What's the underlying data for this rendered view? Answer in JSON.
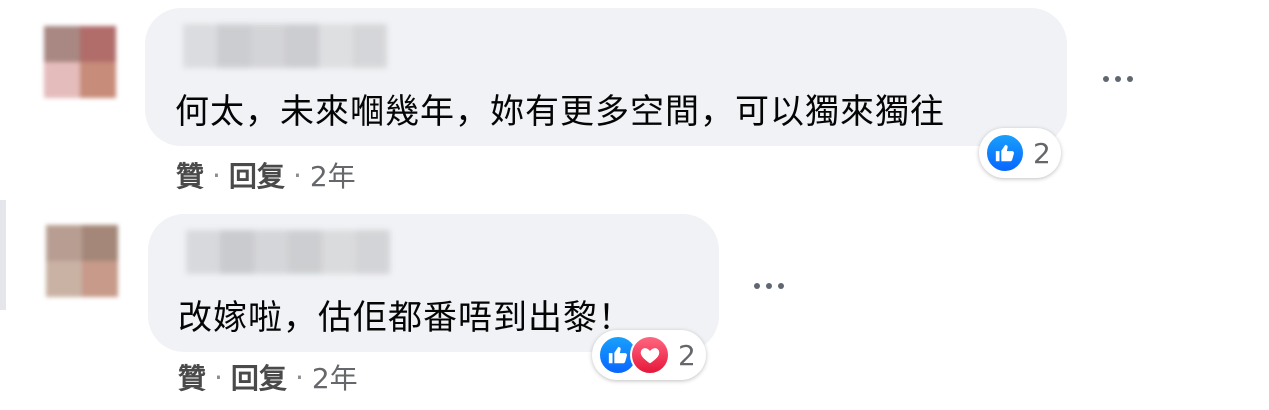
{
  "comments": [
    {
      "text": "何太，未來嗰幾年，妳有更多空間，可以獨來獨往",
      "like_label": "贊",
      "separator": "·",
      "reply_label": "回复",
      "time": "2年",
      "reaction_count": "2",
      "reactions": [
        "like-icon"
      ],
      "avatar_colors": [
        "#a98783",
        "#b06d6a",
        "#e5bcbc",
        "#c78c7a"
      ],
      "name_blur_colors": [
        "#d9dadd",
        "#c9cacd",
        "#d0d1d4",
        "#c8c9cc",
        "#dcdddf",
        "#d3d4d6"
      ]
    },
    {
      "text": "改嫁啦，估佢都番唔到出黎！",
      "like_label": "贊",
      "separator": "·",
      "reply_label": "回复",
      "time": "2年",
      "reaction_count": "2",
      "reactions": [
        "like-icon",
        "love-icon"
      ],
      "avatar_colors": [
        "#b89e92",
        "#a48778",
        "#c9b2a4",
        "#c79a8a"
      ],
      "name_blur_colors": [
        "#d6d7da",
        "#c6c7ca",
        "#d2d3d6",
        "#cacbce",
        "#d8d9db",
        "#d0d1d4"
      ]
    }
  ],
  "colors": {
    "bubble": "#f0f2f5",
    "like": "#0866ff",
    "love": "#e61739"
  }
}
